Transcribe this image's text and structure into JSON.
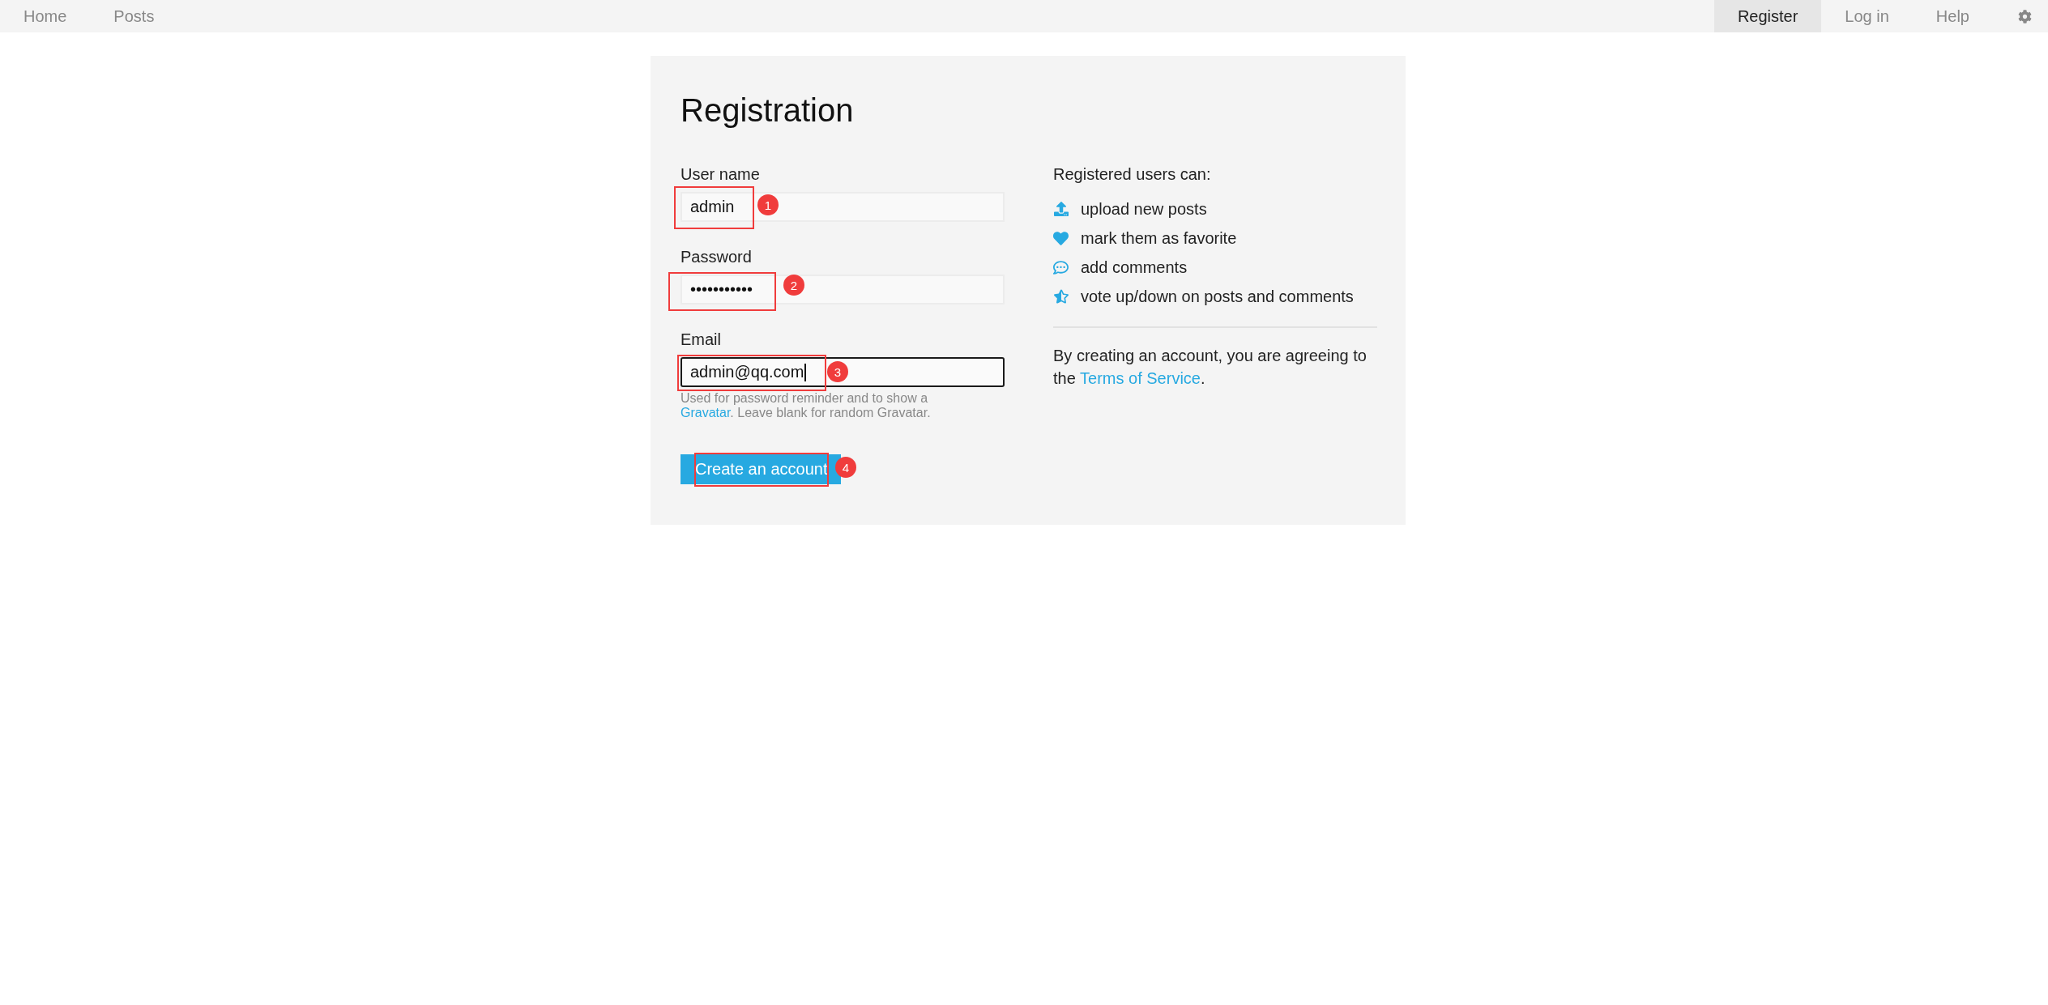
{
  "nav": {
    "left": [
      {
        "label": "Home",
        "selected": false
      },
      {
        "label": "Posts",
        "selected": false
      }
    ],
    "right": [
      {
        "label": "Register",
        "selected": true
      },
      {
        "label": "Log in",
        "selected": false
      },
      {
        "label": "Help",
        "selected": false
      }
    ]
  },
  "panel": {
    "title": "Registration",
    "fields": [
      {
        "label": "User name",
        "value": "admin",
        "focused": false,
        "annotation": "1"
      },
      {
        "label": "Password",
        "value": "•••••••••••",
        "focused": false,
        "annotation": "2"
      },
      {
        "label": "Email",
        "value": "admin@qq.com",
        "focused": true,
        "annotation": "3",
        "hint": {
          "text": "Used for password reminder and to show a",
          "link": "Gravatar",
          "text_after": ". Leave blank for random Gravatar."
        }
      }
    ],
    "submit": {
      "label": "Create an account",
      "annotation": "4"
    },
    "benefits": {
      "heading": "Registered users can:",
      "items": [
        {
          "kind": "upload",
          "text": "upload new posts"
        },
        {
          "kind": "favorite",
          "text": "mark them as favorite"
        },
        {
          "kind": "comment",
          "text": "add comments"
        },
        {
          "kind": "vote",
          "text": "vote up/down on posts and comments"
        }
      ]
    },
    "agreement": {
      "text": "By creating an account, you are agreeing to the",
      "link": "Terms of Service",
      "text_after": "."
    }
  }
}
